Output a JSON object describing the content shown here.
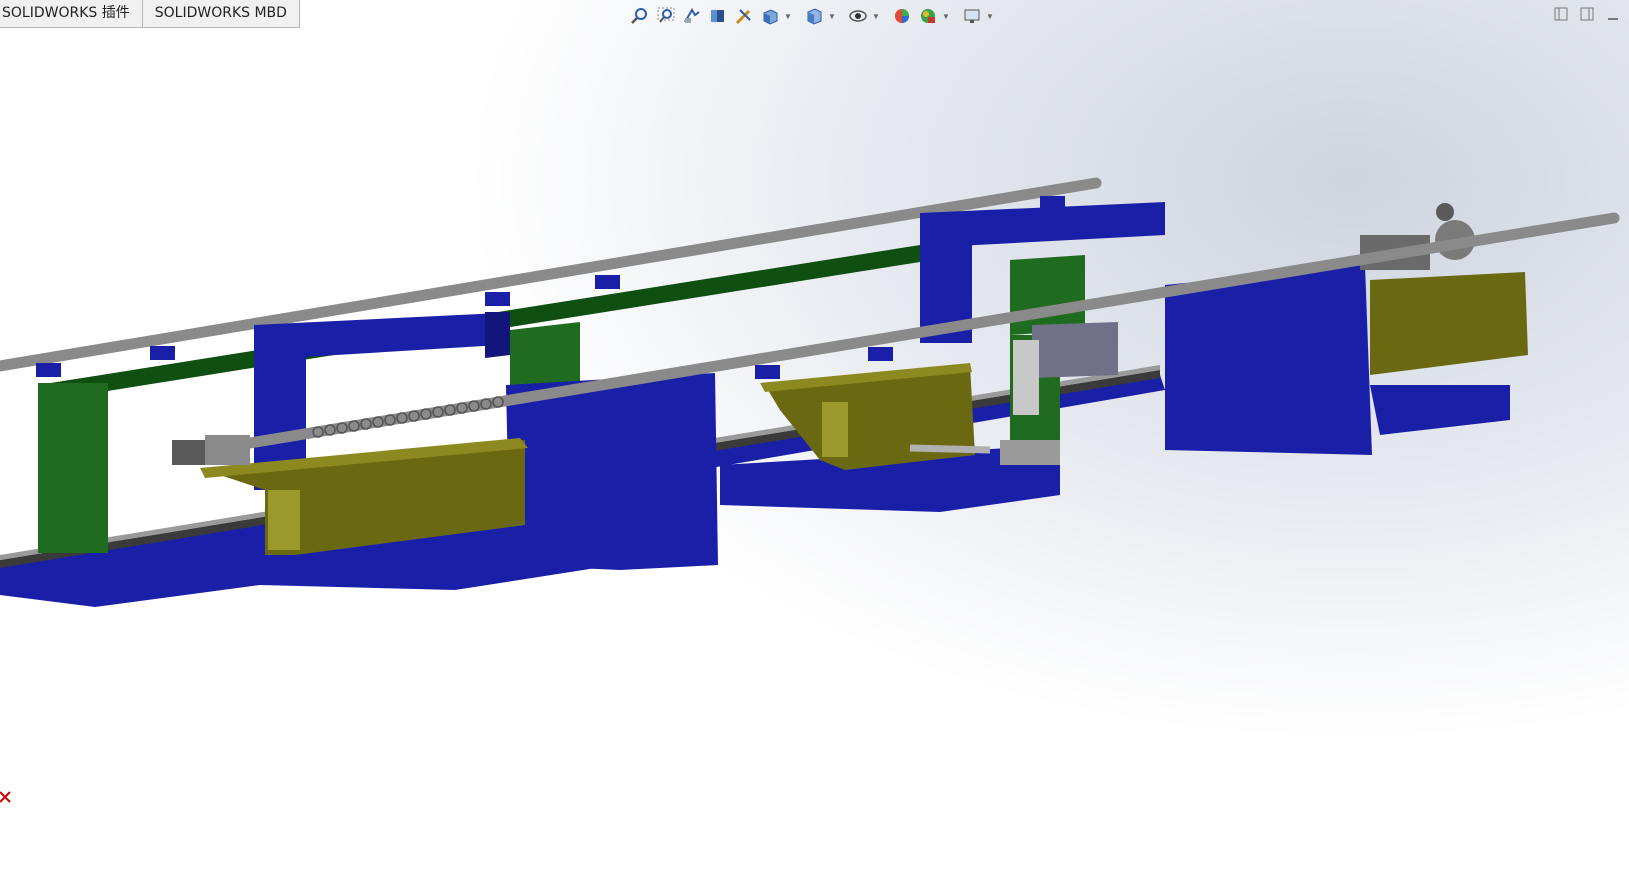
{
  "tabs": [
    {
      "label": "SOLIDWORKS 插件"
    },
    {
      "label": "SOLIDWORKS MBD"
    }
  ],
  "heads_up_toolbar": [
    {
      "icon": "zoom-to-fit-icon"
    },
    {
      "icon": "zoom-to-area-icon"
    },
    {
      "icon": "previous-view-icon"
    },
    {
      "icon": "section-view-icon"
    },
    {
      "icon": "dynamic-annotation-icon"
    },
    {
      "icon": "view-orientation-icon",
      "dropdown": true
    },
    {
      "icon": "display-style-icon",
      "dropdown": true
    },
    {
      "icon": "hide-show-items-icon",
      "dropdown": true
    },
    {
      "icon": "edit-appearance-icon"
    },
    {
      "icon": "apply-scene-icon",
      "dropdown": true
    },
    {
      "icon": "view-settings-icon",
      "dropdown": true
    }
  ],
  "window_controls": [
    {
      "icon": "tile-left-icon"
    },
    {
      "icon": "tile-right-icon"
    },
    {
      "icon": "minimize-icon"
    }
  ],
  "colors": {
    "blue_frame": "#1a1fa8",
    "green_frame": "#0f4f12",
    "olive_carriage": "#77740f",
    "rail_grey": "#8a8a8a",
    "background_highlight": "#cfd4de",
    "triad_red": "#cc0000"
  },
  "triad": {
    "axis": "x"
  }
}
